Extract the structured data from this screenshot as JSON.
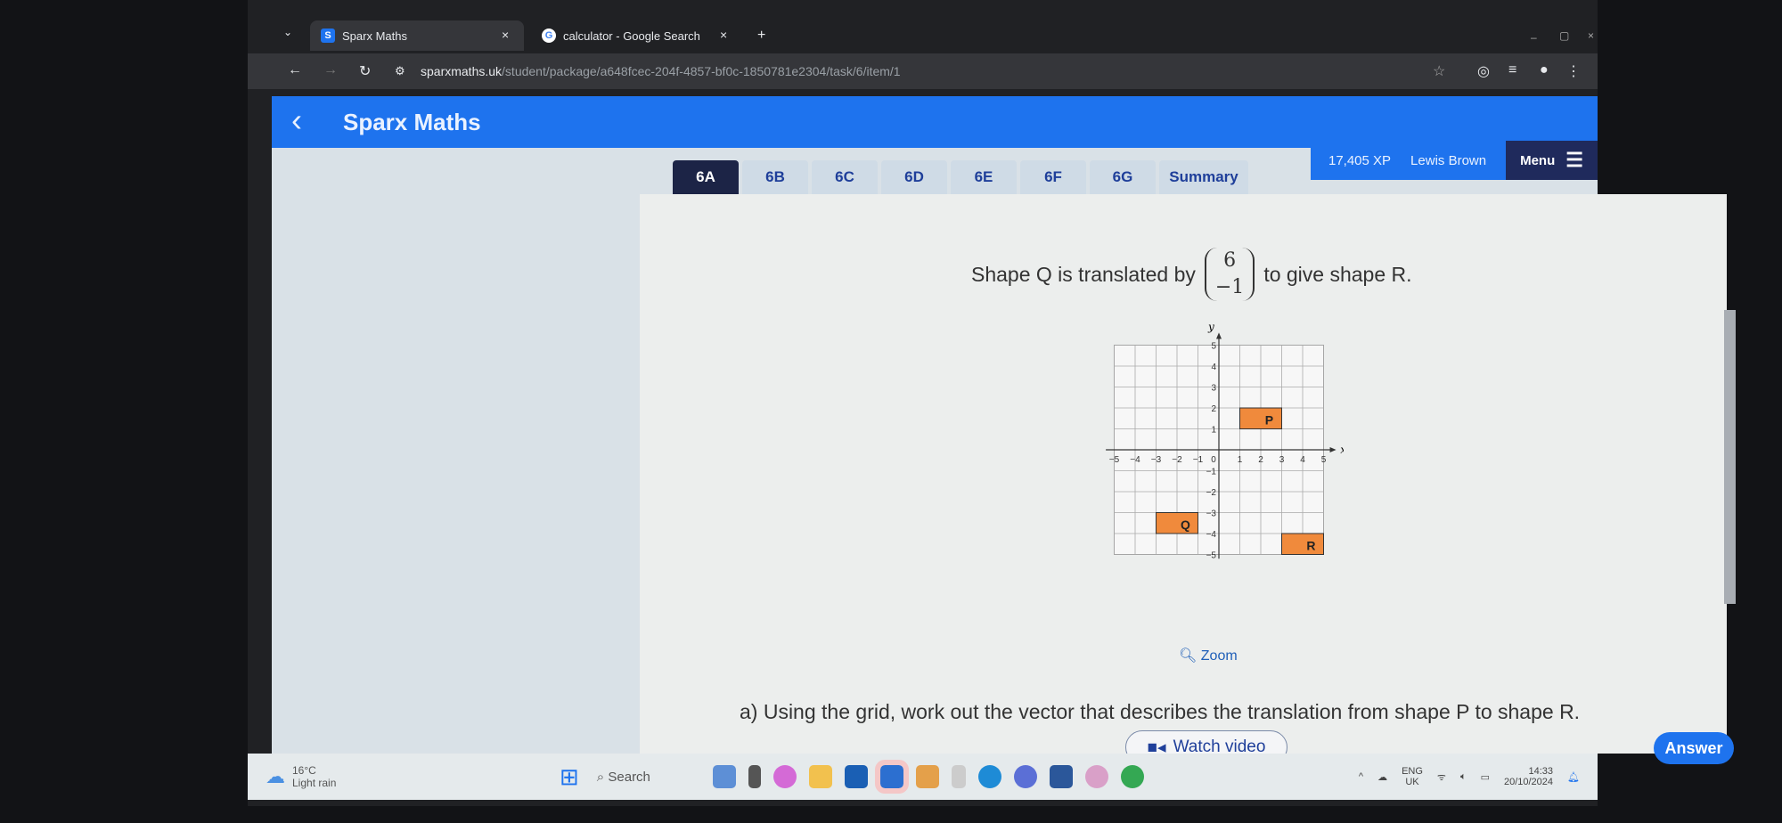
{
  "browser": {
    "tabs": [
      {
        "title": "Sparx Maths",
        "favicon": "S"
      },
      {
        "title": "calculator - Google Search",
        "favicon": "G"
      }
    ],
    "url_host": "sparxmaths.uk",
    "url_path": "/student/package/a648fcec-204f-4857-bf0c-1850781e2304/task/6/item/1"
  },
  "header": {
    "title": "Sparx Maths",
    "xp": "17,405 XP",
    "user": "Lewis Brown",
    "menu": "Menu"
  },
  "tasks": [
    {
      "label": "6A",
      "selected": true
    },
    {
      "label": "6B"
    },
    {
      "label": "6C"
    },
    {
      "label": "6D"
    },
    {
      "label": "6E"
    },
    {
      "label": "6F"
    },
    {
      "label": "6G"
    },
    {
      "label": "Summary"
    }
  ],
  "question": {
    "intro": "Shape Q is translated by",
    "vector_top": "6",
    "vector_bottom": "−1",
    "outro": "to give shape R.",
    "zoom": "Zoom",
    "part_a": "a) Using the grid, work out the vector that describes the translation from shape P to shape R.",
    "watch_video": "Watch video",
    "answer": "Answer"
  },
  "chart_data": {
    "type": "grid",
    "xlabel": "x",
    "ylabel": "y",
    "xlim": [
      -5,
      5
    ],
    "ylim": [
      -5,
      5
    ],
    "grid": true,
    "fill_color": "#f08a3c",
    "shapes": [
      {
        "label": "P",
        "x": [
          1,
          3
        ],
        "y": [
          1,
          2
        ]
      },
      {
        "label": "Q",
        "x": [
          -3,
          -1
        ],
        "y": [
          -4,
          -3
        ]
      },
      {
        "label": "R",
        "x": [
          3,
          5
        ],
        "y": [
          -5,
          -4
        ]
      }
    ]
  },
  "taskbar": {
    "weather_temp": "16°C",
    "weather_desc": "Light rain",
    "search": "Search",
    "lang": "ENG",
    "region": "UK",
    "time": "14:33",
    "date": "20/10/2024"
  }
}
